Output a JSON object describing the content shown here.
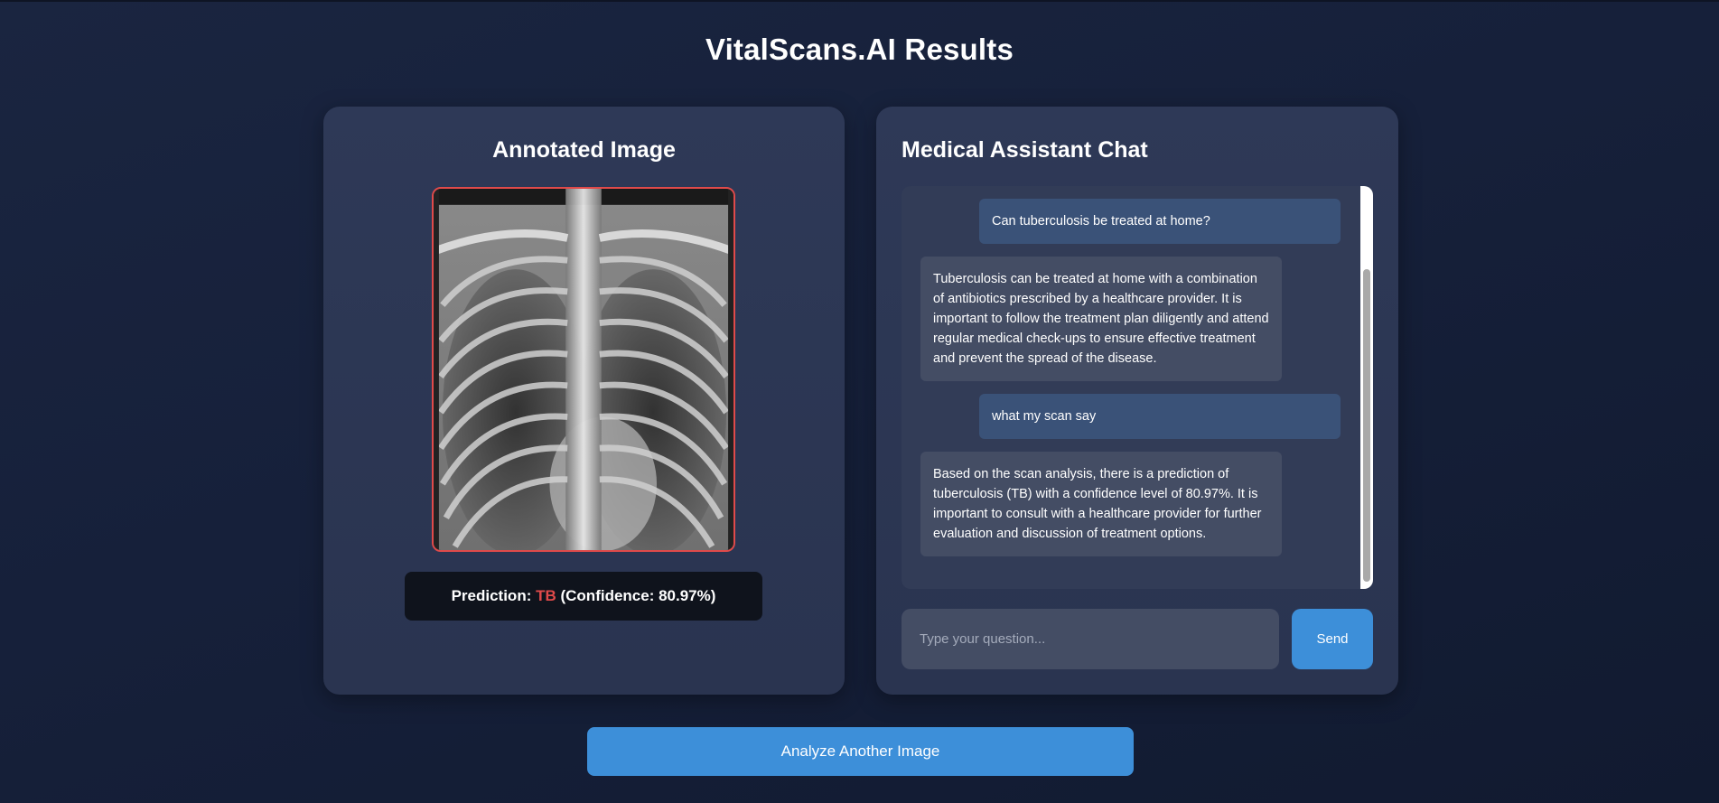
{
  "page": {
    "title": "VitalScans.AI Results"
  },
  "left_panel": {
    "title": "Annotated Image",
    "image_name": "chest-xray",
    "prediction": {
      "prefix": "Prediction: ",
      "label": "TB",
      "confidence_text": " (Confidence: 80.97%)",
      "label_color": "#e04a4a"
    }
  },
  "chat": {
    "title": "Medical Assistant Chat",
    "messages": [
      {
        "role": "user",
        "text": "Can tuberculosis be treated at home?"
      },
      {
        "role": "assistant",
        "text": "Tuberculosis can be treated at home with a combination of antibiotics prescribed by a healthcare provider. It is important to follow the treatment plan diligently and attend regular medical check-ups to ensure effective treatment and prevent the spread of the disease."
      },
      {
        "role": "user",
        "text": "what my scan say"
      },
      {
        "role": "assistant",
        "text": "Based on the scan analysis, there is a prediction of tuberculosis (TB) with a confidence level of 80.97%. It is important to consult with a healthcare provider for further evaluation and discussion of treatment options."
      }
    ],
    "input": {
      "placeholder": "Type your question...",
      "value": ""
    },
    "send_label": "Send"
  },
  "actions": {
    "analyze_label": "Analyze Another Image"
  },
  "colors": {
    "accent": "#3d8fd9",
    "danger": "#e04a4a",
    "card": "#2a3450"
  }
}
